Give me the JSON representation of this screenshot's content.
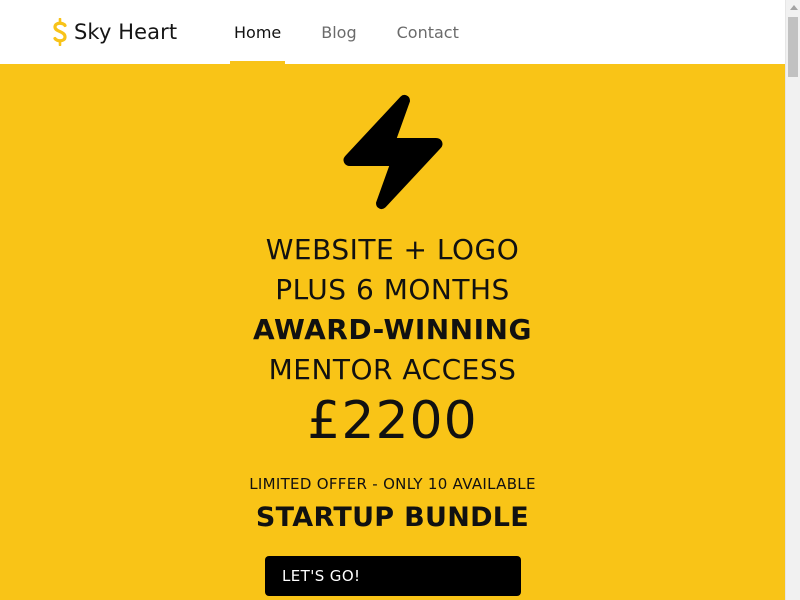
{
  "header": {
    "brand_name": "Sky Heart",
    "brand_icon": "dollar-s-icon",
    "nav": [
      {
        "label": "Home",
        "active": true
      },
      {
        "label": "Blog",
        "active": false
      },
      {
        "label": "Contact",
        "active": false
      }
    ]
  },
  "hero": {
    "icon": "lightning-bolt-icon",
    "lines": [
      "WEBSITE + LOGO",
      "PLUS 6 MONTHS",
      "AWARD-WINNING",
      "MENTOR ACCESS"
    ],
    "price": "£2200",
    "offer": "LIMITED OFFER - ONLY 10 AVAILABLE",
    "bundle_title": "STARTUP BUNDLE",
    "cta_label": "LET'S GO!"
  },
  "colors": {
    "accent_yellow": "#f9c417",
    "button_black": "#000000",
    "header_bg": "#ffffff"
  }
}
